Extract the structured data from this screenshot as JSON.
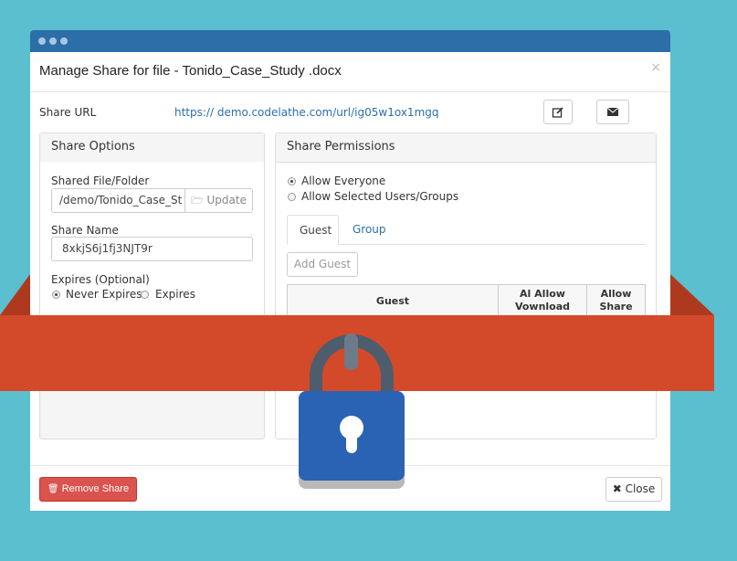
{
  "modal": {
    "title": "Manage Share for file - Tonido_Case_Study .docx",
    "close_x": "×",
    "share_url_label": "Share URL",
    "share_url": "https:// demo.codelathe.com/url/ig05w1ox1mgq",
    "edit_icon": "edit-icon",
    "mail_icon": "envelope-icon"
  },
  "share_options": {
    "heading": "Share Options",
    "shared_file_label": "Shared File/Folder",
    "shared_file_value": "/demo/Tonido_Case_St",
    "update_label": "Update",
    "share_name_label": "Share Name",
    "share_name_value": "8xkjS6j1fj3NJT9r",
    "expires_label": "Expires (Optional)",
    "never_expires": "Never Expires",
    "expires": "Expires",
    "selected_expiry": "Never Expires"
  },
  "share_permissions": {
    "heading": "Share Permissions",
    "allow_everyone": "Allow Everyone",
    "allow_selected": "Allow Selected Users/Groups",
    "selected_option": "Allow Everyone",
    "tabs": [
      "Guest",
      "Group"
    ],
    "active_tab": "Guest",
    "add_guest": "Add Guest",
    "columns": [
      "Guest",
      "Al  Allow\nVownload",
      "Allow\nShare"
    ]
  },
  "footer": {
    "remove_share": "Remove Share",
    "close": "Close"
  },
  "colors": {
    "background": "#5bbfcf",
    "titlebar": "#2b6ea8",
    "banner": "#d34a2a",
    "lock_body": "#2a63b3",
    "danger": "#d9534f"
  }
}
